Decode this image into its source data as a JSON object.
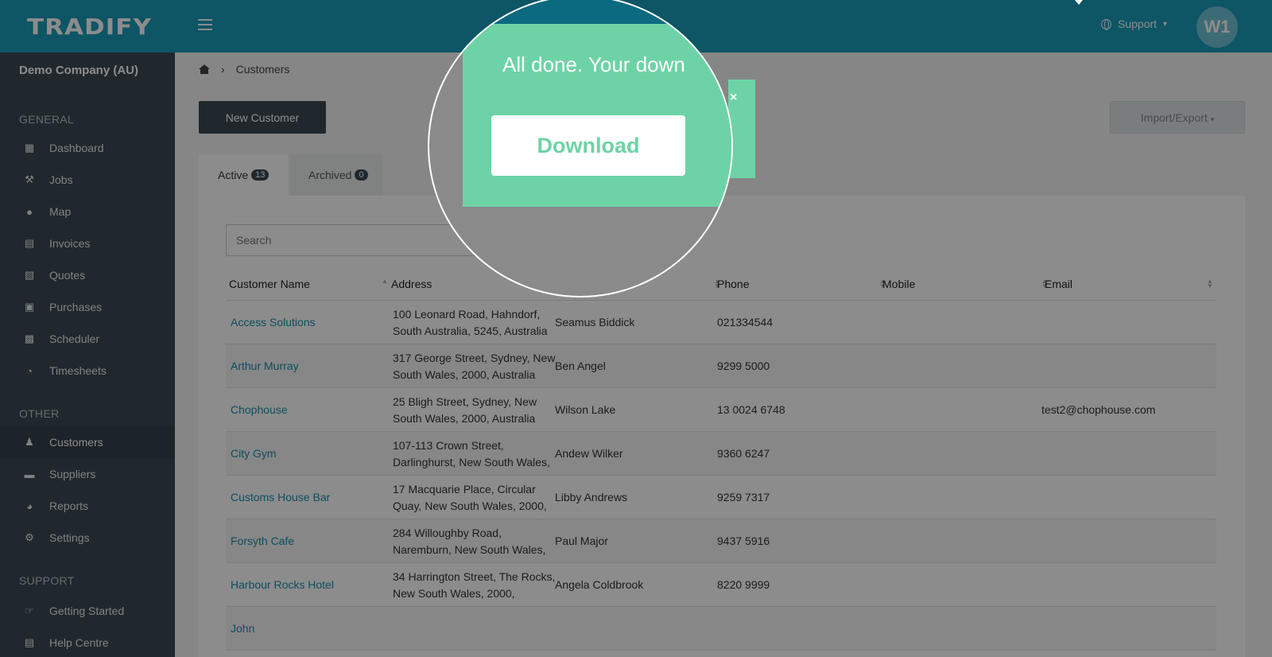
{
  "header": {
    "logo": "TRADIFY",
    "support_label": "Support",
    "avatar_initials": "W1",
    "brand_color": "#1a9bb8"
  },
  "sidebar": {
    "company": "Demo Company (AU)",
    "sections": [
      {
        "title": "GENERAL",
        "items": [
          {
            "label": "Dashboard",
            "icon": "dashboard-icon"
          },
          {
            "label": "Jobs",
            "icon": "hammer-icon"
          },
          {
            "label": "Map",
            "icon": "map-pin-icon"
          },
          {
            "label": "Invoices",
            "icon": "invoice-icon"
          },
          {
            "label": "Quotes",
            "icon": "calculator-icon"
          },
          {
            "label": "Purchases",
            "icon": "cart-icon"
          },
          {
            "label": "Scheduler",
            "icon": "calendar-icon"
          },
          {
            "label": "Timesheets",
            "icon": "clock-icon"
          }
        ]
      },
      {
        "title": "OTHER",
        "items": [
          {
            "label": "Customers",
            "icon": "users-icon",
            "active": true
          },
          {
            "label": "Suppliers",
            "icon": "truck-icon"
          },
          {
            "label": "Reports",
            "icon": "pie-chart-icon"
          },
          {
            "label": "Settings",
            "icon": "gear-icon"
          }
        ]
      },
      {
        "title": "SUPPORT",
        "items": [
          {
            "label": "Getting Started",
            "icon": "thumbs-up-icon"
          },
          {
            "label": "Help Centre",
            "icon": "book-icon"
          }
        ]
      }
    ]
  },
  "main": {
    "breadcrumb": "Customers",
    "new_customer_label": "New Customer",
    "import_export_label": "Import/Export",
    "tabs": [
      {
        "label": "Active",
        "count": "13"
      },
      {
        "label": "Archived",
        "count": "0"
      }
    ],
    "search_placeholder": "Search",
    "columns": [
      "Customer Name",
      "Address",
      "Phone",
      "Mobile",
      "Email"
    ],
    "rows": [
      {
        "name": "Access Solutions",
        "address": "100 Leonard Road, Hahndorf, South Australia, 5245, Australia",
        "contact": "Seamus Biddick",
        "phone": "021334544",
        "email": ""
      },
      {
        "name": "Arthur Murray",
        "address": "317 George Street, Sydney, New South Wales, 2000, Australia",
        "contact": "Ben Angel",
        "phone": "9299 5000",
        "email": ""
      },
      {
        "name": "Chophouse",
        "address": "25 Bligh Street, Sydney, New South Wales, 2000, Australia",
        "contact": "Wilson Lake",
        "phone": "13 0024 6748",
        "email": "test2@chophouse.com"
      },
      {
        "name": "City Gym",
        "address": "107-113 Crown Street, Darlinghurst, New South Wales,",
        "contact": "Andew Wilker",
        "phone": "9360 6247",
        "email": ""
      },
      {
        "name": "Customs House Bar",
        "address": "17 Macquarie Place, Circular Quay, New South Wales, 2000,",
        "contact": "Libby Andrews",
        "phone": "9259 7317",
        "email": ""
      },
      {
        "name": "Forsyth Cafe",
        "address": "284 Willoughby Road, Naremburn, New South Wales,",
        "contact": "Paul Major",
        "phone": "9437 5916",
        "email": ""
      },
      {
        "name": "Harbour Rocks Hotel",
        "address": "34 Harrington Street, The Rocks, New South Wales, 2000,",
        "contact": "Angela Coldbrook",
        "phone": "8220 9999",
        "email": ""
      },
      {
        "name": "John",
        "address": "",
        "contact": "",
        "phone": "",
        "email": ""
      }
    ]
  },
  "toast": {
    "message": "All done. Your down",
    "download_label": "Download",
    "close_label": "×",
    "color": "#6dd3a6"
  }
}
